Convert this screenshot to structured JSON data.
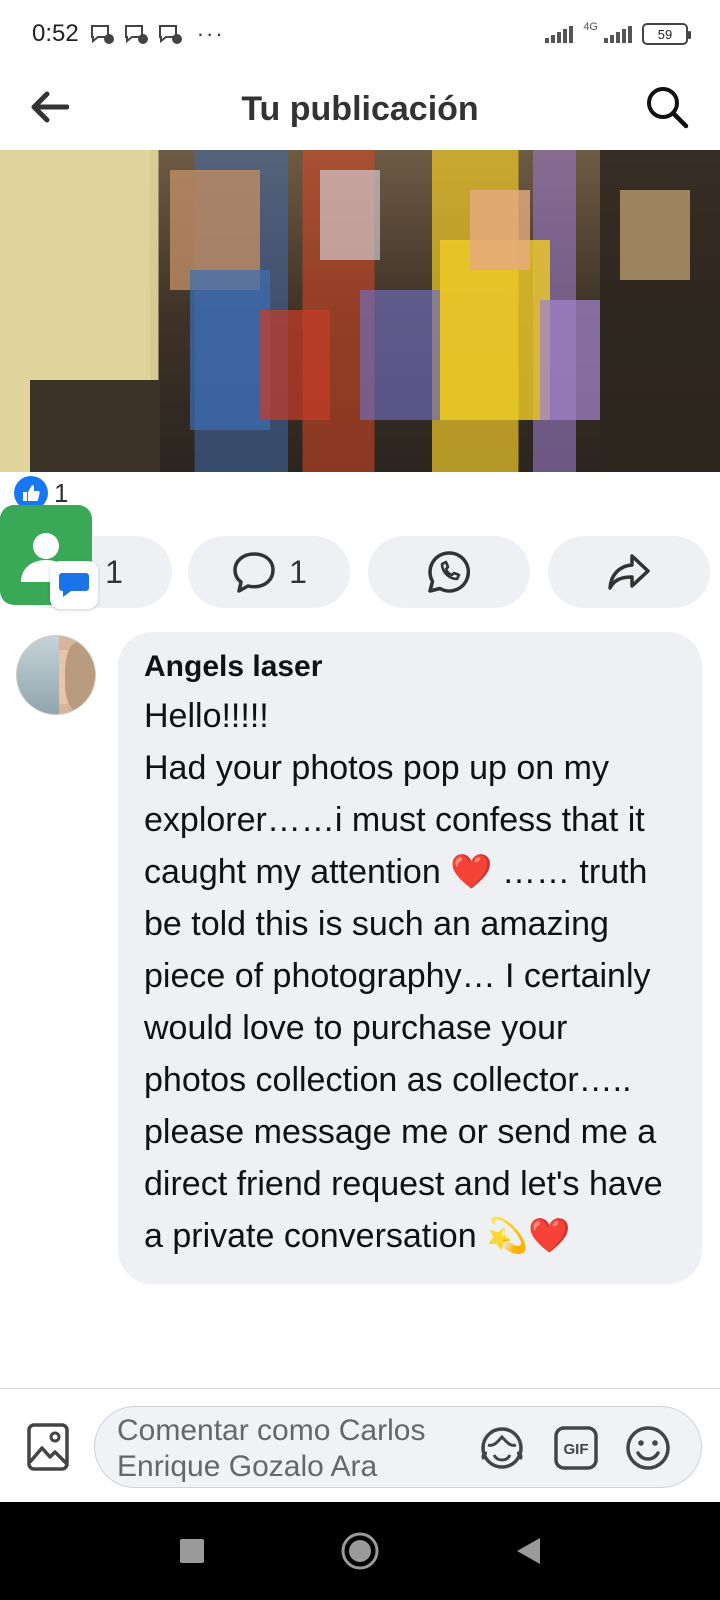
{
  "status_bar": {
    "time": "0:52",
    "overflow": "···",
    "network_label": "4G",
    "battery": "59",
    "icons": [
      "messenger-notification-icon",
      "messenger-notification-icon",
      "messenger-notification-icon"
    ]
  },
  "header": {
    "title": "Tu publicación",
    "back_icon": "arrow-left-icon",
    "search_icon": "search-icon"
  },
  "post": {
    "reaction_count": "1",
    "actions": {
      "like_count": "1",
      "comment_count": "1",
      "whatsapp_icon": "whatsapp-icon",
      "share_icon": "share-icon"
    }
  },
  "comment": {
    "author": "Angels laser",
    "text": "Hello!!!!!\nHad your photos pop up on my explorer……i must confess that it caught my attention ❤️ …… truth be told this is such an amazing piece of photography… I certainly would love to purchase your photos collection as collector….. please message me or send me a direct friend request and let's have a private conversation 💫❤️"
  },
  "composer": {
    "placeholder": "Comentar como Carlos Enrique Gozalo Ara",
    "icons": [
      "photo-icon",
      "avatar-sticker-icon",
      "gif-icon",
      "emoji-icon"
    ]
  },
  "nav": {
    "icons": [
      "recents-icon",
      "home-icon",
      "back-icon"
    ]
  },
  "colors": {
    "accent": "#1877f2",
    "pill_bg": "#eef0f3",
    "bubble_bg": "#eff0f3",
    "chat_head": "#3aa957"
  }
}
